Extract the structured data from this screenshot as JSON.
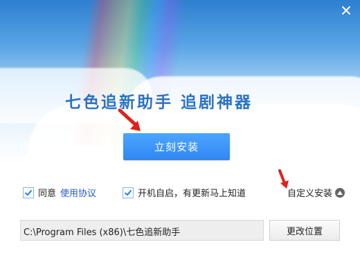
{
  "window": {
    "slogan": "七色追新助手  追剧神器",
    "close_label": "×"
  },
  "install": {
    "label": "立刻安装"
  },
  "options": {
    "agree_label": "同意",
    "agree_link": "使用协议",
    "startup_label": "开机自启，有更新马上知道",
    "custom_label": "自定义安装"
  },
  "path": {
    "value": "C:\\Program Files (x86)\\七色追新助手",
    "change_label": "更改位置"
  },
  "colors": {
    "accent": "#2f87f2",
    "link": "#1f57d6",
    "annotation_arrow": "#e0211b"
  },
  "icons": {
    "close": "close-icon",
    "checkbox": "check-icon",
    "custom_toggle": "triangle-up-icon",
    "annotation": "red-arrow-icon"
  }
}
